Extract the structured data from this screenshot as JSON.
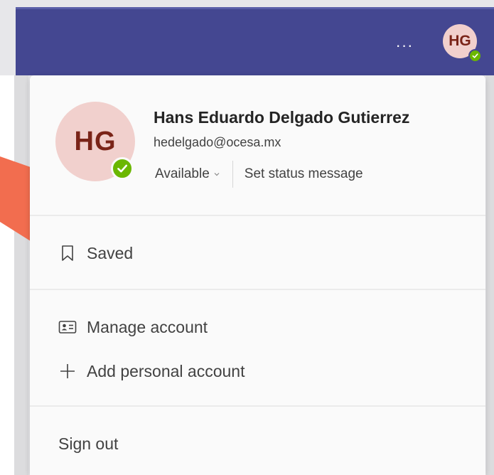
{
  "header": {
    "more_label": "···",
    "avatar_initials": "HG"
  },
  "profile": {
    "initials": "HG",
    "name": "Hans Eduardo Delgado Gutierrez",
    "email": "hedelgado@ocesa.mx",
    "status": "Available",
    "set_status_message": "Set status message"
  },
  "menu": {
    "saved": "Saved",
    "manage_account": "Manage account",
    "add_personal_account": "Add personal account",
    "sign_out": "Sign out"
  },
  "colors": {
    "header_bg": "#444791",
    "presence_available": "#6bb700",
    "avatar_bg": "#f1d0cd",
    "avatar_text": "#7a2418",
    "arrow": "#f26d4f"
  },
  "icons": {
    "saved": "bookmark-icon",
    "manage_account": "contact-card-icon",
    "add_personal_account": "plus-icon",
    "presence": "checkmark-icon",
    "more": "more-horizontal-icon",
    "status_dropdown": "chevron-down-icon"
  }
}
